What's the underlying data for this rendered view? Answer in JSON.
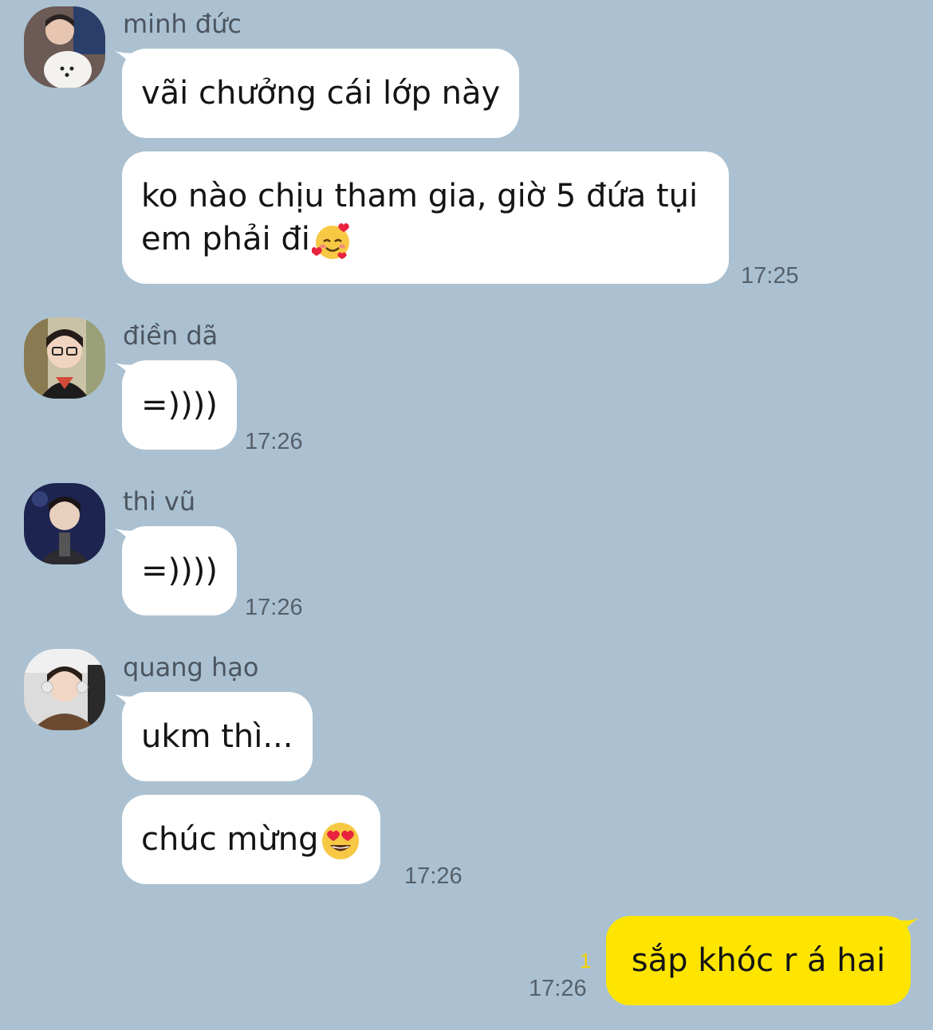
{
  "colors": {
    "background": "#abc1d1",
    "incoming_bubble": "#ffffff",
    "outgoing_bubble": "#fee500",
    "unread_count": "#f5d200"
  },
  "messages": [
    {
      "sender": "minh đức",
      "avatar": "avatar-photo",
      "bubbles": [
        "vãi chưởng cái lớp này",
        "ko nào chịu tham gia, giờ 5 đứa tụi em phải đi"
      ],
      "emoji": "smiling-face-with-hearts-icon",
      "time": "17:25"
    },
    {
      "sender": "điền dã",
      "avatar": "avatar-photo",
      "bubbles": [
        "=))))"
      ],
      "time": "17:26"
    },
    {
      "sender": "thi vũ",
      "avatar": "avatar-photo",
      "bubbles": [
        "=))))"
      ],
      "time": "17:26"
    },
    {
      "sender": "quang hạo",
      "avatar": "avatar-photo",
      "bubbles": [
        "ukm thì...",
        "chúc mừng"
      ],
      "emoji": "heart-eyes-icon",
      "time": "17:26"
    }
  ],
  "outgoing": {
    "text": "sắp khóc r á hai",
    "time": "17:26",
    "unread": "1"
  }
}
